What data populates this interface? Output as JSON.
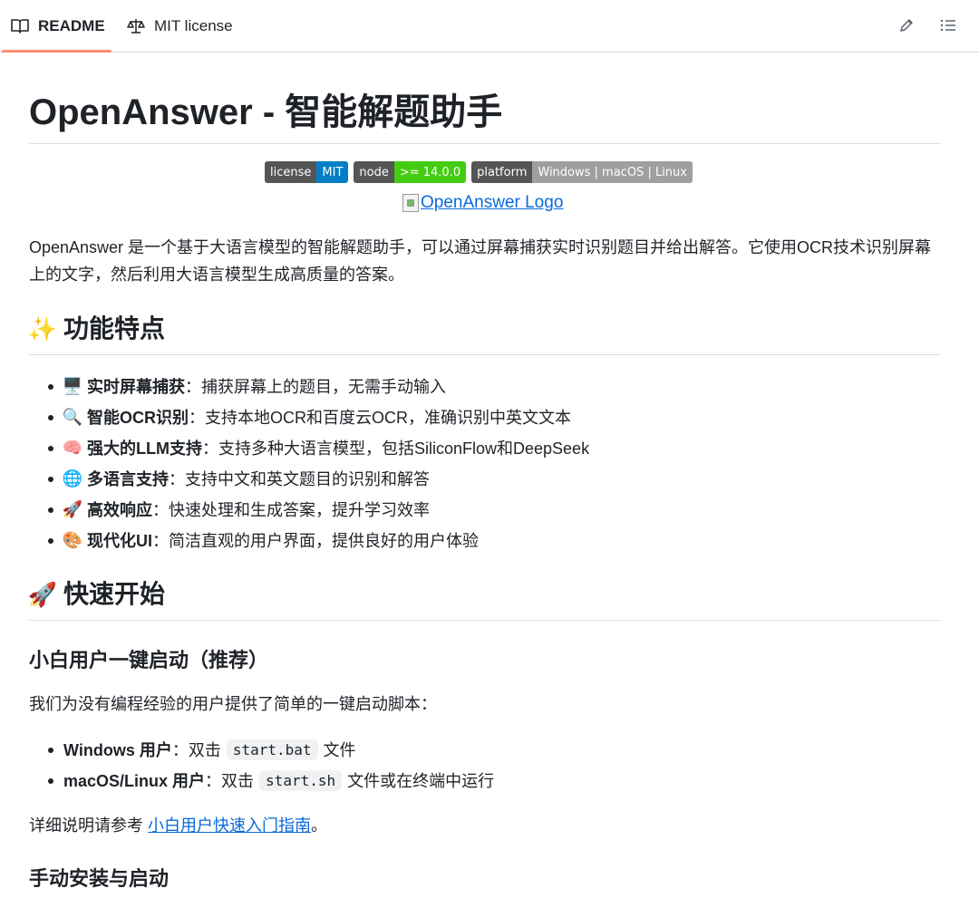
{
  "tabs": {
    "readme": "README",
    "license": "MIT license"
  },
  "toolbar": {
    "edit_icon": "pencil-icon",
    "toc_icon": "list-icon"
  },
  "title": "OpenAnswer - 智能解题助手",
  "badges": [
    {
      "label": "license",
      "value": "MIT",
      "color": "#007ec6"
    },
    {
      "label": "node",
      "value": ">= 14.0.0",
      "color": "#44cc11"
    },
    {
      "label": "platform",
      "value": "Windows | macOS | Linux",
      "color": "#9f9f9f"
    }
  ],
  "logo_alt": "OpenAnswer Logo",
  "intro": "OpenAnswer 是一个基于大语言模型的智能解题助手，可以通过屏幕捕获实时识别题目并给出解答。它使用OCR技术识别屏幕上的文字，然后利用大语言模型生成高质量的答案。",
  "features": {
    "heading": "功能特点",
    "heading_emoji": "✨",
    "items": [
      {
        "emoji": "🖥️",
        "name": "实时屏幕捕获",
        "desc": "：捕获屏幕上的题目，无需手动输入"
      },
      {
        "emoji": "🔍",
        "name": "智能OCR识别",
        "desc": "：支持本地OCR和百度云OCR，准确识别中英文文本"
      },
      {
        "emoji": "🧠",
        "name": "强大的LLM支持",
        "desc": "：支持多种大语言模型，包括SiliconFlow和DeepSeek"
      },
      {
        "emoji": "🌐",
        "name": "多语言支持",
        "desc": "：支持中文和英文题目的识别和解答"
      },
      {
        "emoji": "🚀",
        "name": "高效响应",
        "desc": "：快速处理和生成答案，提升学习效率"
      },
      {
        "emoji": "🎨",
        "name": "现代化UI",
        "desc": "：简洁直观的用户界面，提供良好的用户体验"
      }
    ]
  },
  "quickstart": {
    "heading": "快速开始",
    "heading_emoji": "🚀",
    "oneclick_heading": "小白用户一键启动（推荐）",
    "oneclick_desc": "我们为没有编程经验的用户提供了简单的一键启动脚本：",
    "launch_items": [
      {
        "name": "Windows 用户",
        "pre": "：双击",
        "code": "start.bat",
        "post": "文件"
      },
      {
        "name": "macOS/Linux 用户",
        "pre": "：双击",
        "code": "start.sh",
        "post": "文件或在终端中运行"
      }
    ],
    "detail_prefix": "详细说明请参考 ",
    "detail_link": "小白用户快速入门指南",
    "detail_suffix": "。",
    "manual_heading": "手动安装与启动"
  }
}
